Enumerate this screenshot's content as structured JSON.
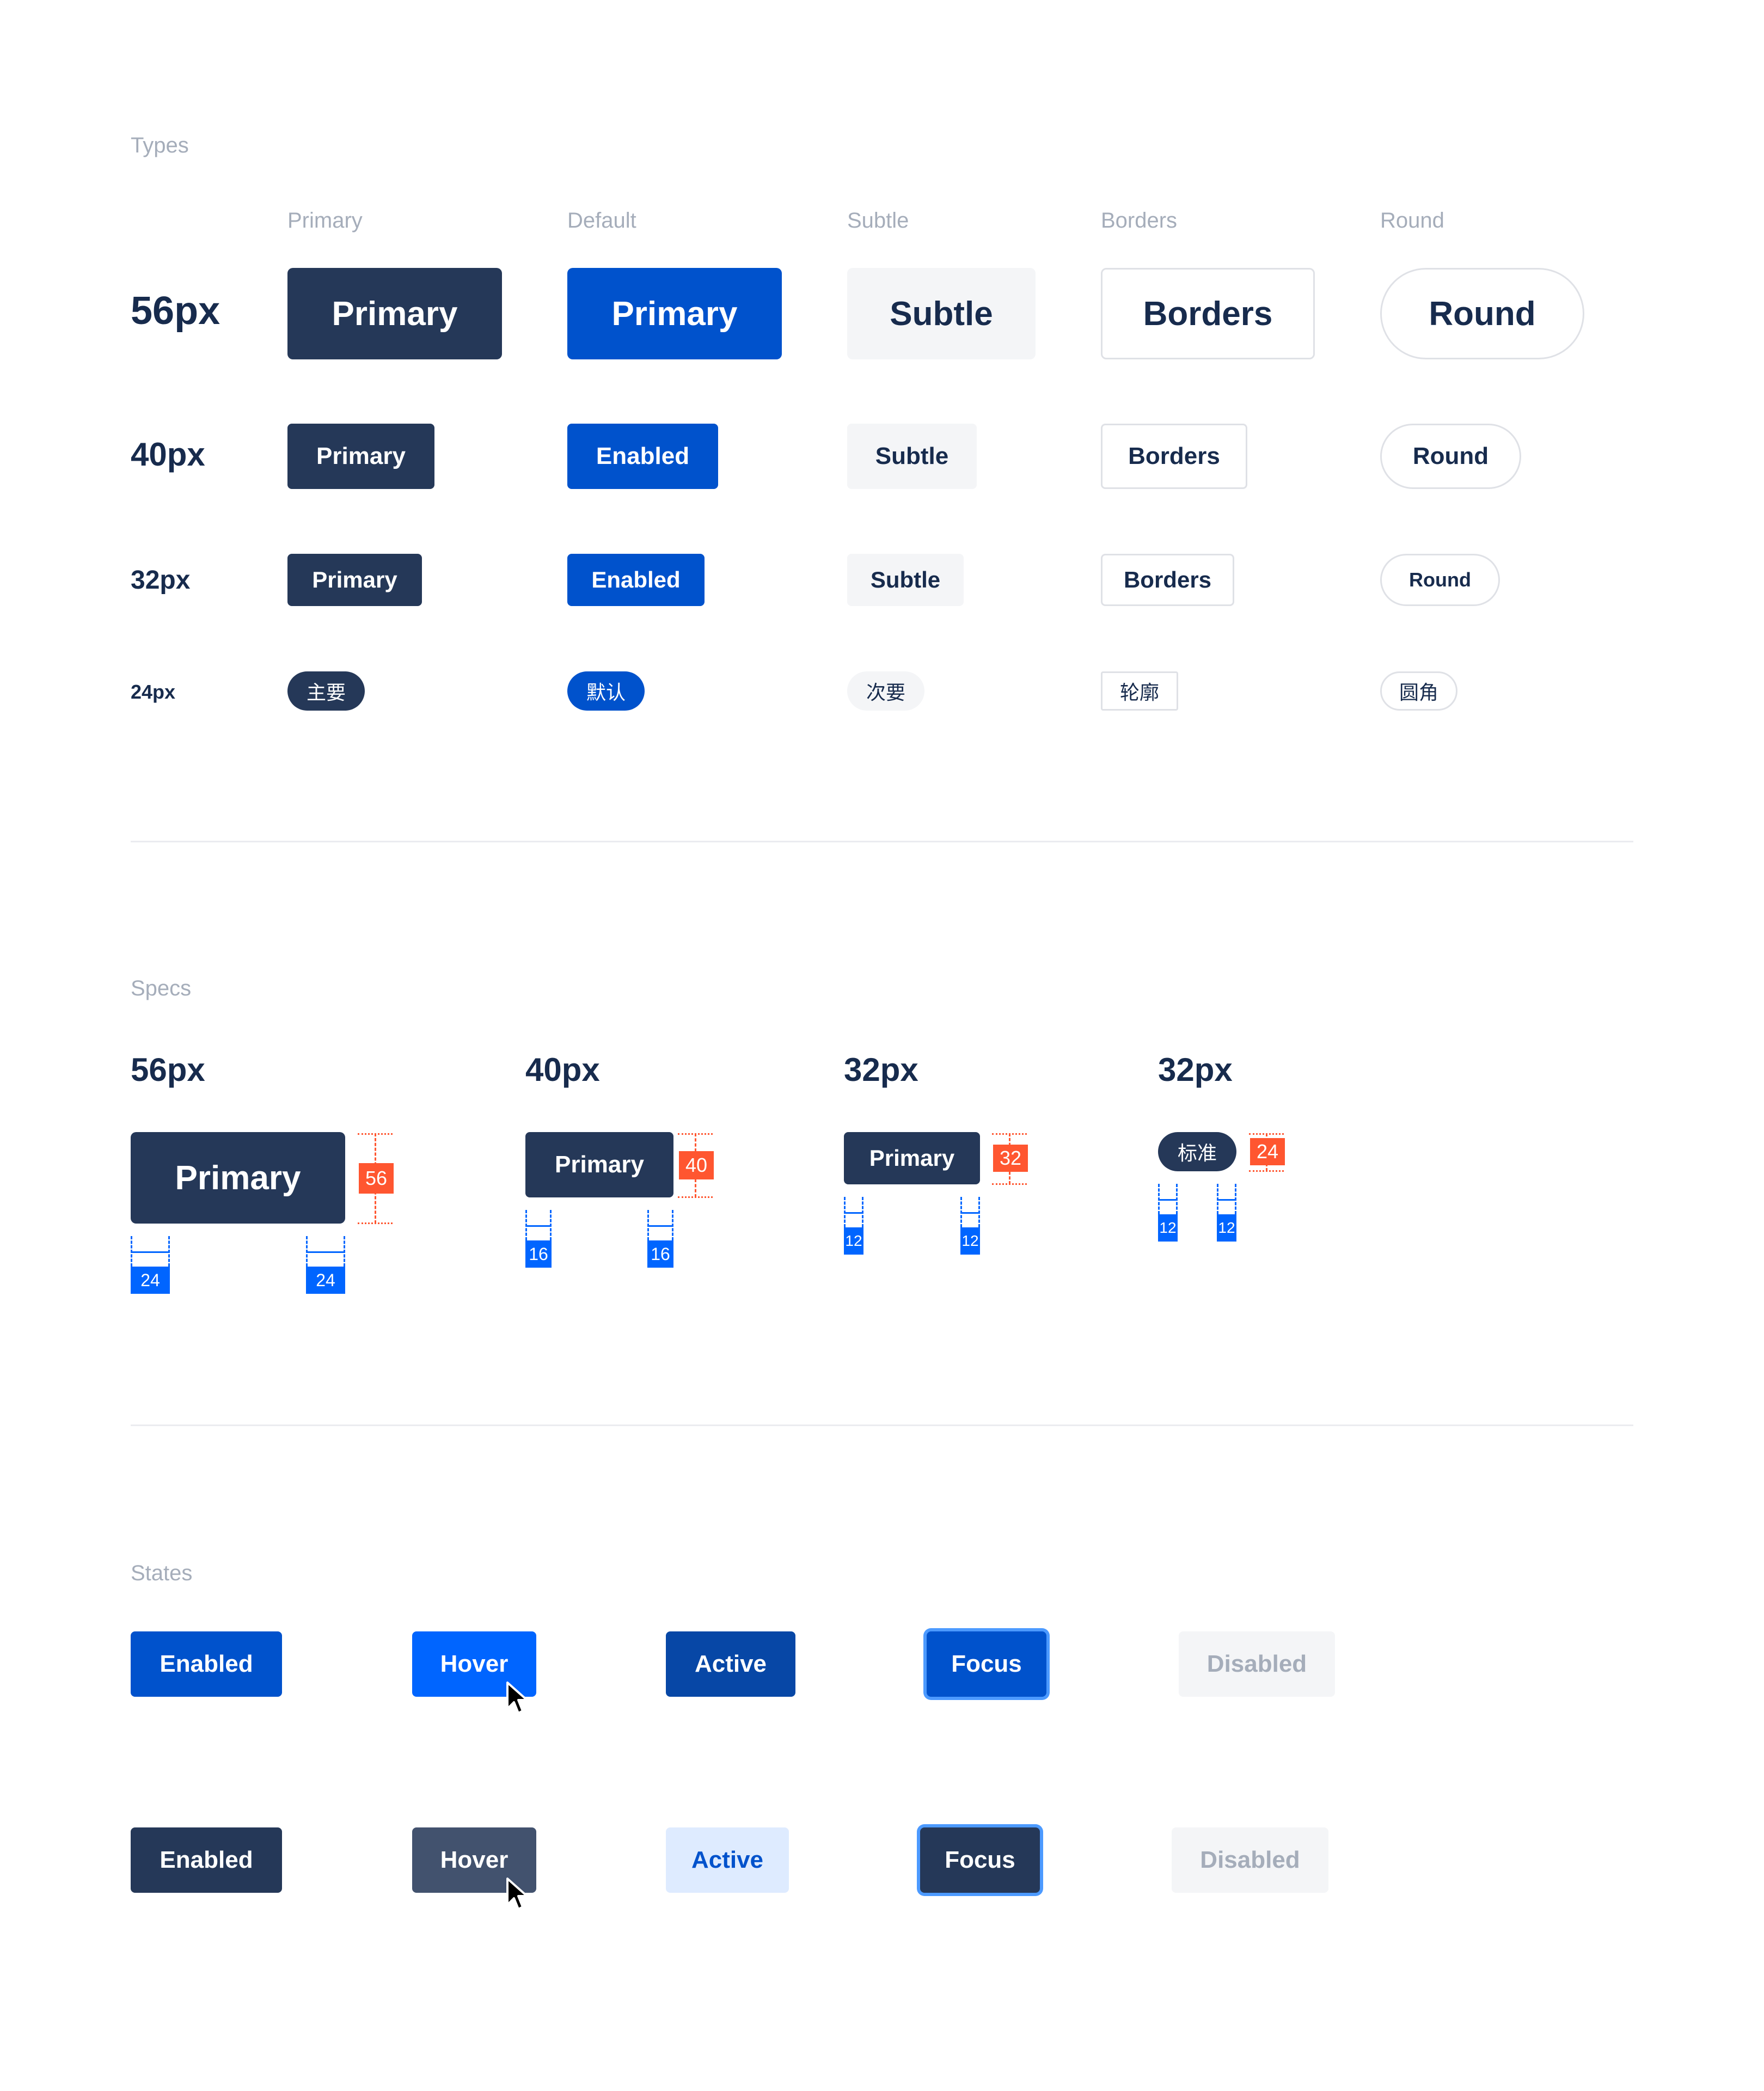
{
  "types": {
    "title": "Types",
    "columns": [
      "Primary",
      "Default",
      "Subtle",
      "Borders",
      "Round"
    ],
    "rows": [
      {
        "size": "56px",
        "labels": [
          "Primary",
          "Primary",
          "Subtle",
          "Borders",
          "Round"
        ]
      },
      {
        "size": "40px",
        "labels": [
          "Primary",
          "Enabled",
          "Subtle",
          "Borders",
          "Round"
        ]
      },
      {
        "size": "32px",
        "labels": [
          "Primary",
          "Enabled",
          "Subtle",
          "Borders",
          "Round"
        ]
      },
      {
        "size": "24px",
        "labels": [
          "主要",
          "默认",
          "次要",
          "轮廓",
          "圆角"
        ]
      }
    ]
  },
  "specs": {
    "title": "Specs",
    "items": [
      {
        "size": "56px",
        "label": "Primary",
        "height": "56",
        "padding": "24"
      },
      {
        "size": "40px",
        "label": "Primary",
        "height": "40",
        "padding": "16"
      },
      {
        "size": "32px",
        "label": "Primary",
        "height": "32",
        "padding": "12"
      },
      {
        "size": "32px",
        "label": "标准",
        "height": "24",
        "padding": "12"
      }
    ]
  },
  "states": {
    "title": "States",
    "row1": [
      "Enabled",
      "Hover",
      "Active",
      "Focus",
      "Disabled"
    ],
    "row2": [
      "Enabled",
      "Hover",
      "Active",
      "Focus",
      "Disabled"
    ]
  },
  "colors": {
    "primary": "#253858",
    "default": "#0052CC",
    "hover_blue": "#0065FF",
    "active_blue": "#0747A6",
    "focus_ring": "#4C9AFF",
    "spec_red": "#FF5630",
    "spec_blue": "#0065FF"
  }
}
